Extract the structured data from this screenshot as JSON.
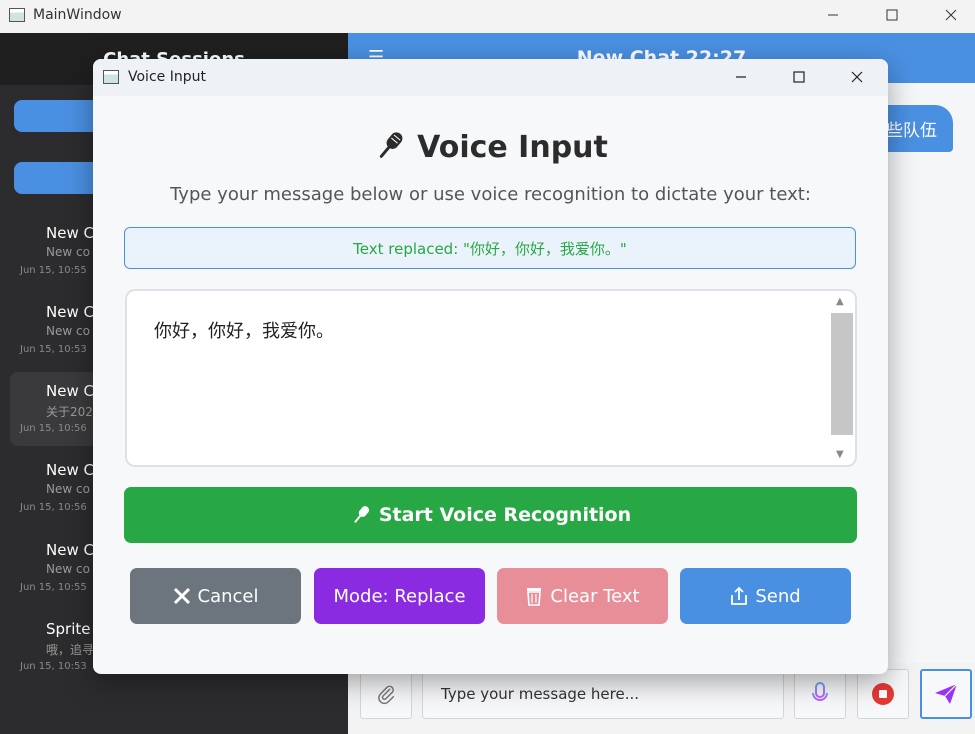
{
  "main_window": {
    "title": "MainWindow"
  },
  "sidebar": {
    "header": "Chat Sessions",
    "sessions": [
      {
        "title": "New C",
        "preview": "New co",
        "time": "Jun 15, 10:55"
      },
      {
        "title": "New C",
        "preview": "New co",
        "time": "Jun 15, 10:53"
      },
      {
        "title": "New C",
        "preview": "关于202",
        "time": "Jun 15, 10:56",
        "active": true
      },
      {
        "title": "New C",
        "preview": "New co",
        "time": "Jun 15, 10:56"
      },
      {
        "title": "New C",
        "preview": "New co",
        "time": "Jun 15, 10:55"
      },
      {
        "title": "Sprite",
        "preview": "哦，追寻",
        "time": "Jun 15, 10:53"
      }
    ]
  },
  "chat": {
    "header_title": "New Chat 22:27",
    "message_partial": "些队伍",
    "input_placeholder": "Type your message here..."
  },
  "dialog": {
    "title": "Voice Input",
    "heading": "Voice Input",
    "subtitle": "Type your message below or use voice recognition to dictate your text:",
    "status": "Text replaced: \"你好，你好，我爱你。\"",
    "text_content": "你好，你好，我爱你。",
    "voice_button": "Start Voice Recognition",
    "buttons": {
      "cancel": "Cancel",
      "mode": "Mode: Replace",
      "clear": "Clear Text",
      "send": "Send"
    }
  },
  "colors": {
    "accent_blue": "#4a90e2",
    "voice_green": "#28a745",
    "cancel_gray": "#6c757d",
    "mode_purple": "#8a2be2",
    "clear_pink": "#e88e99",
    "sidebar_dark": "#2c2c2e"
  }
}
